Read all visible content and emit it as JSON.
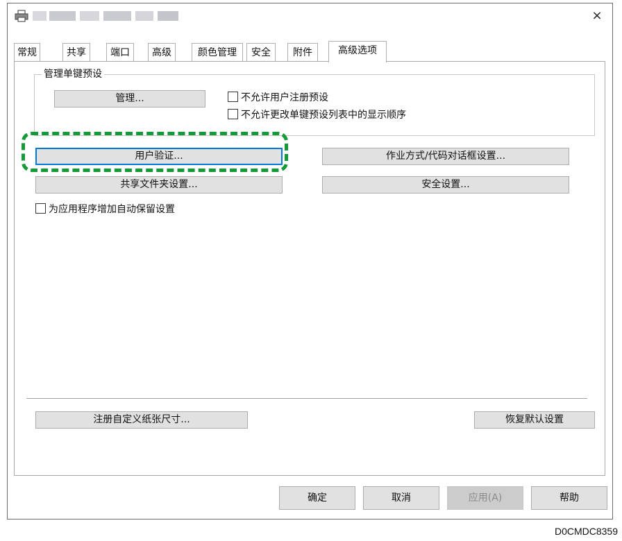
{
  "window": {
    "close_glyph": "×",
    "printer_icon": "printer-icon"
  },
  "tabs": [
    {
      "label": "常规"
    },
    {
      "label": "共享"
    },
    {
      "label": "端口"
    },
    {
      "label": "高级"
    },
    {
      "label": "颜色管理"
    },
    {
      "label": "安全"
    },
    {
      "label": "附件"
    },
    {
      "label": "高级选项",
      "active": true
    }
  ],
  "one_touch_group": {
    "label": "管理单键预设",
    "manage_button": "管理...",
    "checkboxes": [
      {
        "label": "不允许用户注册预设",
        "checked": false
      },
      {
        "label": "不允许更改单键预设列表中的显示顺序",
        "checked": false
      }
    ]
  },
  "buttons": {
    "user_auth": "用户验证...",
    "job_type": "作业方式/代码对话框设置...",
    "shared_folder": "共享文件夹设置...",
    "security": "安全设置...",
    "register_paper": "注册自定义纸张尺寸...",
    "restore_defaults": "恢复默认设置"
  },
  "auto_retention_checkbox": {
    "label": "为应用程序增加自动保留设置",
    "checked": false
  },
  "footer": {
    "ok": "确定",
    "cancel": "取消",
    "apply": "应用(A)",
    "help": "帮助"
  },
  "annotation": {
    "color": "#159a38",
    "doc_code": "D0CMDC8359"
  }
}
